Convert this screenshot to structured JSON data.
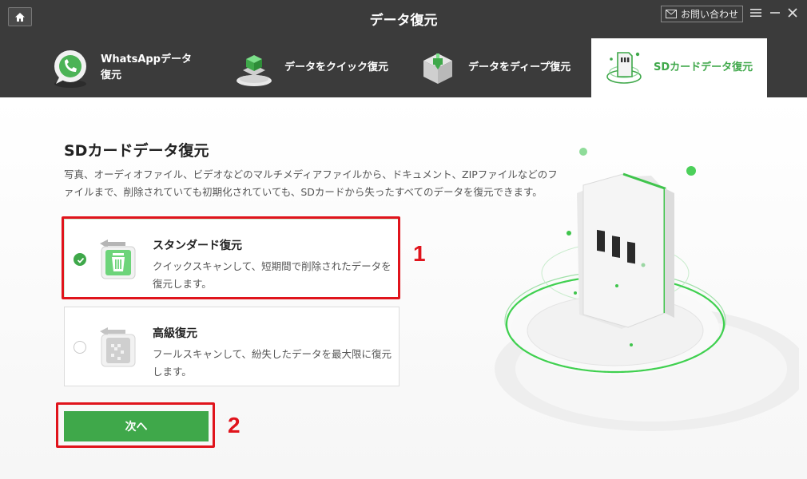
{
  "app": {
    "title": "データ復元",
    "contact_label": "お問い合わせ",
    "menu_icon": "hamburger-icon",
    "minimize_icon": "minimize-icon",
    "close_icon": "close-icon",
    "home_icon": "home-icon"
  },
  "tabs": [
    {
      "label": "WhatsAppデータ復元",
      "icon": "whatsapp-phone-icon",
      "active": false
    },
    {
      "label": "データをクイック復元",
      "icon": "quick-cube-icon",
      "active": false
    },
    {
      "label": "データをディープ復元",
      "icon": "deep-cube-icon",
      "active": false
    },
    {
      "label": "SDカードデータ復元",
      "icon": "sd-card-icon",
      "active": true
    }
  ],
  "main": {
    "title": "SDカードデータ復元",
    "description": "写真、オーディオファイル、ビデオなどのマルチメディアファイルから、ドキュメント、ZIPファイルなどのファイルまで、削除されていても初期化されていても、SDカードから失ったすべてのデータを復元できます。",
    "options": [
      {
        "title": "スタンダード復元",
        "description": "クイックスキャンして、短期間で削除されたデータを復元します。",
        "selected": true,
        "icon": "trash-restore-icon"
      },
      {
        "title": "高級復元",
        "description": "フールスキャンして、紛失したデータを最大限に復元します。",
        "selected": false,
        "icon": "file-restore-icon"
      }
    ],
    "next_label": "次へ"
  },
  "annotations": {
    "step1": "1",
    "step2": "2"
  },
  "colors": {
    "accent": "#3fa84a",
    "topbar": "#3b3b3b",
    "highlight": "#e0141c"
  }
}
